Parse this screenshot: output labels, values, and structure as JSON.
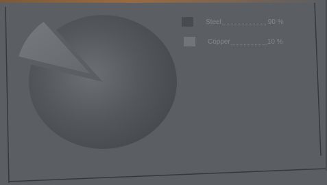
{
  "colors": {
    "background": "#5b5e63",
    "steel": "#484b50",
    "copper": "#717478"
  },
  "chart_data": {
    "type": "pie",
    "labels": [
      "Steel",
      "Copper"
    ],
    "values": [
      90,
      10
    ],
    "value_labels": [
      "90 %",
      "10 %"
    ],
    "legend": "top-right",
    "exploded": [
      "Copper"
    ]
  }
}
